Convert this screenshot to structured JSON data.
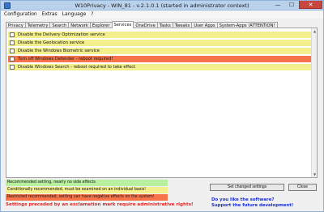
{
  "window": {
    "title": "W10Privacy - WIN_81 - v.2.1.0.1 (started in administrator context)",
    "min_glyph": "—",
    "max_glyph": "☐",
    "close_glyph": "✕"
  },
  "menu": [
    "Configuration",
    "Extras",
    "Language",
    "?"
  ],
  "tabs": [
    {
      "label": "Privacy",
      "active": false
    },
    {
      "label": "Telemetry",
      "active": false
    },
    {
      "label": "Search",
      "active": false
    },
    {
      "label": "Network",
      "active": false
    },
    {
      "label": "Explorer",
      "active": false
    },
    {
      "label": "Services",
      "active": true
    },
    {
      "label": "OneDrive",
      "active": false
    },
    {
      "label": "Tasks",
      "active": false
    },
    {
      "label": "Tweaks",
      "active": false
    },
    {
      "label": "User Apps",
      "active": false
    },
    {
      "label": "System-Apps !ATTENTION!",
      "active": false
    }
  ],
  "settings": [
    {
      "label": "Disable the Delivery Optimization service",
      "level": "yellow",
      "checked": false
    },
    {
      "label": "Disable the Geolocation service",
      "level": "yellow",
      "checked": false
    },
    {
      "label": "Disable the Windows Biometric service",
      "level": "yellow",
      "checked": false
    },
    {
      "label": "Turn off Windows Defender - reboot required!",
      "level": "red",
      "checked": false
    },
    {
      "label": "Disable Windows Search - reboot required to take effect",
      "level": "yellow",
      "checked": false
    }
  ],
  "colors": {
    "green": "#b8f0a0",
    "yellow": "#f3ef8c",
    "red": "#f7744a"
  },
  "legend": [
    {
      "text": "Recommended setting, nearly no side effects",
      "level": "green"
    },
    {
      "text": "Conditionally recommended, must be examined on an individual basis!",
      "level": "yellow"
    },
    {
      "text": "Restricted recommended, setting can have negative effects on the system!",
      "level": "red"
    }
  ],
  "admin_note": "Settings preceded by an exclamation mark require administrative rights!",
  "buttons": {
    "set_changed": "Set changed settings",
    "close": "Close"
  },
  "promo": {
    "line1": "Do you like the software?",
    "line2": "Support the future development!"
  },
  "scrollbar": {
    "up_glyph": "▲",
    "down_glyph": "▼"
  }
}
